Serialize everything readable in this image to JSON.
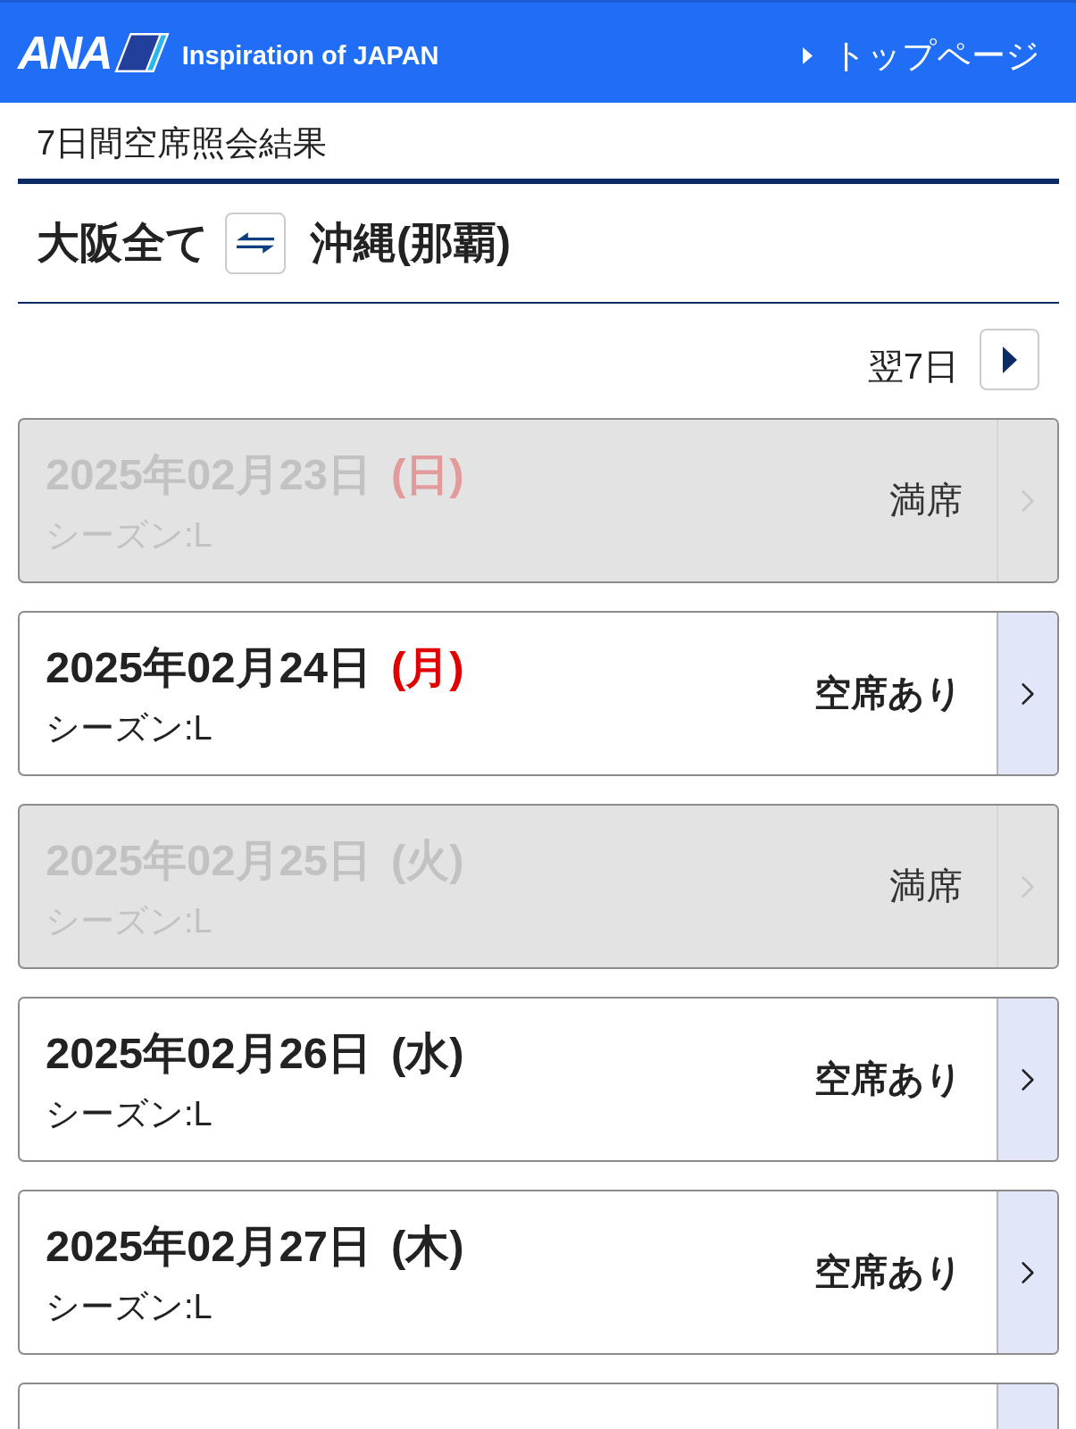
{
  "header": {
    "logo": "ANA",
    "tagline": "Inspiration of JAPAN",
    "top_link": "トップページ"
  },
  "page_title": "7日間空席照会結果",
  "route": {
    "origin": "大阪全て",
    "destination": "沖縄(那覇)"
  },
  "next_week": {
    "label": "翌7日"
  },
  "days": [
    {
      "date": "2025年02月23日",
      "weekday": "(日)",
      "holiday": true,
      "season": "シーズン:L",
      "status": "満席",
      "disabled": true
    },
    {
      "date": "2025年02月24日",
      "weekday": "(月)",
      "holiday": true,
      "season": "シーズン:L",
      "status": "空席あり",
      "disabled": false
    },
    {
      "date": "2025年02月25日",
      "weekday": "(火)",
      "holiday": false,
      "season": "シーズン:L",
      "status": "満席",
      "disabled": true
    },
    {
      "date": "2025年02月26日",
      "weekday": "(水)",
      "holiday": false,
      "season": "シーズン:L",
      "status": "空席あり",
      "disabled": false
    },
    {
      "date": "2025年02月27日",
      "weekday": "(木)",
      "holiday": false,
      "season": "シーズン:L",
      "status": "空席あり",
      "disabled": false
    },
    {
      "disabled": false
    }
  ]
}
